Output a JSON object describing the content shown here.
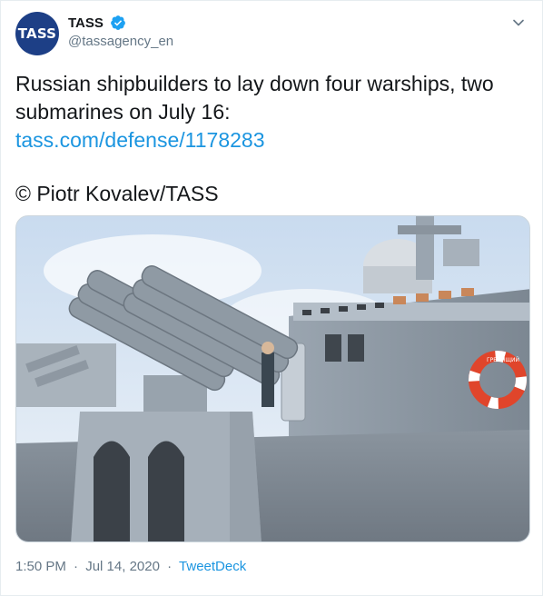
{
  "account": {
    "display_name": "TASS",
    "handle": "@tassagency_en",
    "avatar_text": "TASS",
    "verified": true
  },
  "tweet": {
    "text_line1": "Russian shipbuilders to lay down four warships, two",
    "text_line2": "submarines on July 16:",
    "link_text": "tass.com/defense/1178283",
    "credit": "© Piotr Kovalev/TASS"
  },
  "media": {
    "alt": "warship deck with missile launcher",
    "lifebuoy_text": "ГРЕМЯЩИЙ"
  },
  "meta": {
    "time": "1:50 PM",
    "separator": "·",
    "date": "Jul 14, 2020",
    "source": "TweetDeck"
  },
  "colors": {
    "link": "#1b95e0",
    "muted": "#657786",
    "avatar_bg": "#1d3f86",
    "verified": "#1da1f2"
  },
  "icons": {
    "verified": "verified-badge-icon",
    "caret": "chevron-down-icon"
  }
}
